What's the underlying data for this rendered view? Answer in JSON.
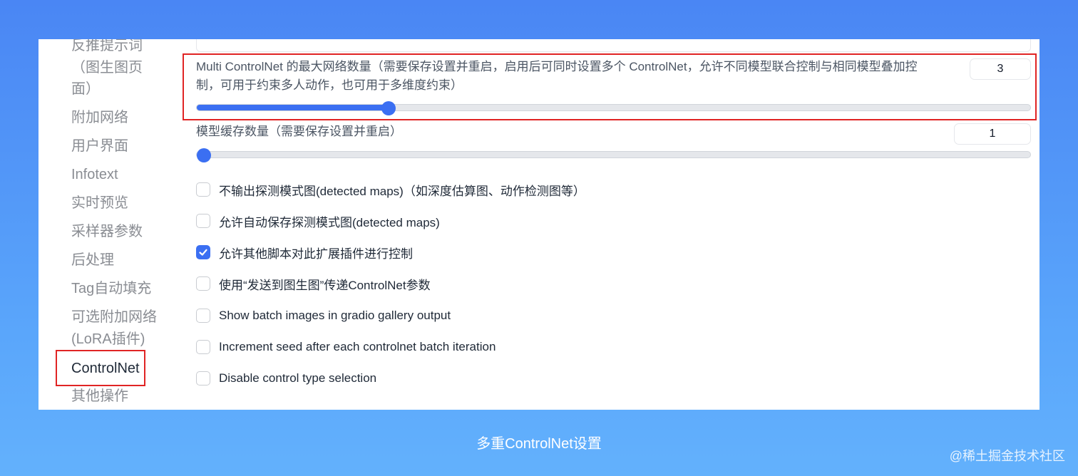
{
  "sidebar": {
    "items": [
      {
        "label": "反推提示词"
      },
      {
        "label": "（图生图页"
      },
      {
        "label": "面）"
      },
      {
        "label": "附加网络"
      },
      {
        "label": "用户界面"
      },
      {
        "label": "Infotext"
      },
      {
        "label": "实时预览"
      },
      {
        "label": "采样器参数"
      },
      {
        "label": "后处理"
      },
      {
        "label": "Tag自动填充"
      },
      {
        "label": "可选附加网络"
      },
      {
        "label": "(LoRA插件)"
      },
      {
        "label": "ControlNet"
      },
      {
        "label": "其他操作"
      }
    ],
    "active": "ControlNet"
  },
  "settings": {
    "max_models": {
      "label_line1": "Multi ControlNet 的最大网络数量（需要保存设置并重启，启用后可同时设置多个 ControlNet，允许不同模型联合控制与相同模型叠加控",
      "label_line2": "制，可用于约束多人动作，也可用于多维度约束）",
      "value": "3",
      "slider_fraction": 0.23
    },
    "cache_models": {
      "label": "模型缓存数量（需要保存设置并重启）",
      "value": "1",
      "slider_fraction": 0.0
    },
    "checkboxes": [
      {
        "label": "不输出探测模式图(detected maps)（如深度估算图、动作检测图等）",
        "checked": false
      },
      {
        "label": "允许自动保存探测模式图(detected maps)",
        "checked": false
      },
      {
        "label": "允许其他脚本对此扩展插件进行控制",
        "checked": true
      },
      {
        "label": "使用“发送到图生图”传递ControlNet参数",
        "checked": false
      },
      {
        "label": "Show batch images in gradio gallery output",
        "checked": false
      },
      {
        "label": "Increment seed after each controlnet batch iteration",
        "checked": false
      },
      {
        "label": "Disable control type selection",
        "checked": false
      }
    ]
  },
  "caption": "多重ControlNet设置",
  "watermark": "@稀土掘金技术社区",
  "colors": {
    "accent": "#3b6ff2",
    "highlight": "#e02424"
  }
}
